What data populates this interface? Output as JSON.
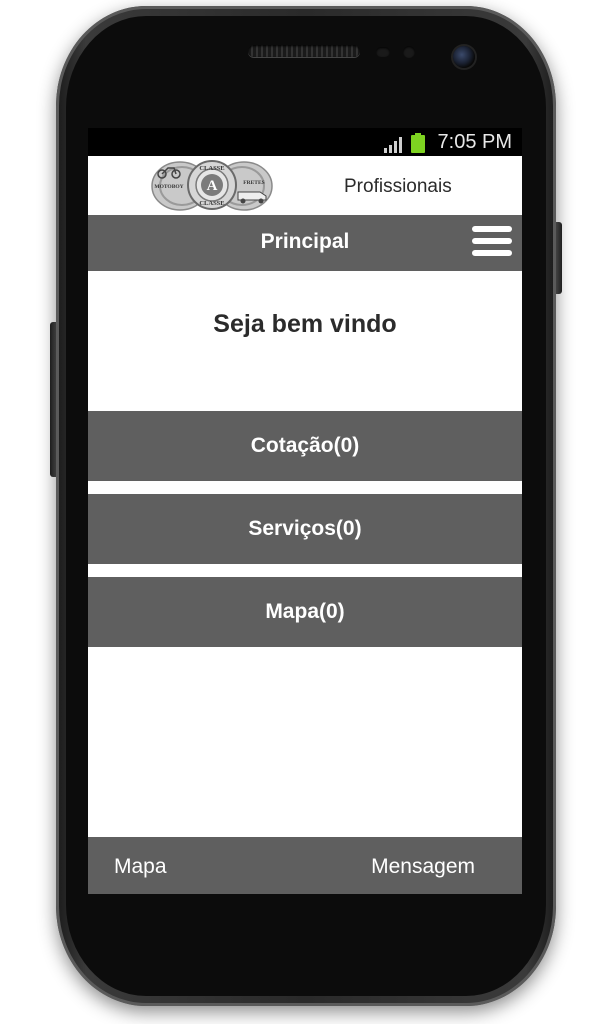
{
  "status_bar": {
    "time": "7:05 PM",
    "signal_icon": "signal-icon",
    "battery_icon": "battery-icon",
    "battery_color": "#7ed321"
  },
  "header": {
    "logo_icon": "classe-a-logo",
    "logo_text": {
      "top": "CLASSE",
      "letter": "A",
      "bottom": "CLASSE",
      "left": "MOTOBOY",
      "right": "FRETES"
    },
    "title": "Profissionais"
  },
  "nav": {
    "title": "Principal",
    "menu_icon": "hamburger-menu-icon"
  },
  "main": {
    "welcome": "Seja bem vindo",
    "buttons": [
      {
        "label": "Cotação(0)"
      },
      {
        "label": "Serviços(0)"
      },
      {
        "label": "Mapa(0)"
      }
    ]
  },
  "footer": {
    "left_link": "Mapa",
    "right_link": "Mensagem"
  },
  "colors": {
    "bar_gray": "#5f5f5f",
    "text_dark": "#2b2b2b",
    "text_light": "#ffffff"
  }
}
